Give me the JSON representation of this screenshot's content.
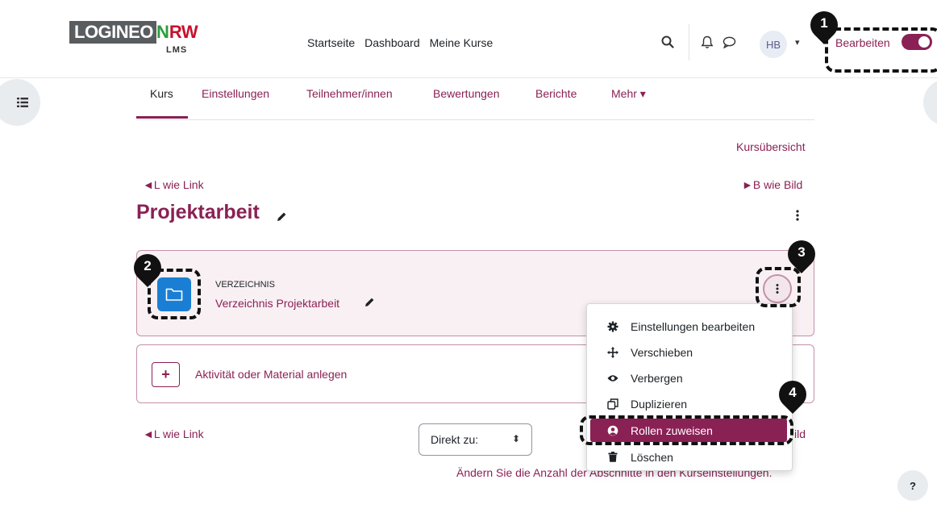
{
  "brand": {
    "logineo": "LOGINEO",
    "nrw_n": "N",
    "nrw_rw": "RW",
    "sub": "LMS"
  },
  "topnav": {
    "items": [
      "Startseite",
      "Dashboard",
      "Meine Kurse"
    ]
  },
  "user": {
    "initials": "HB"
  },
  "edit_mode": {
    "label": "Bearbeiten",
    "on": true
  },
  "tabs": [
    {
      "label": "Kurs"
    },
    {
      "label": "Einstellungen"
    },
    {
      "label": "Teilnehmer/innen"
    },
    {
      "label": "Bewertungen"
    },
    {
      "label": "Berichte"
    },
    {
      "label": "Mehr ▾"
    }
  ],
  "course_overview": "Kursübersicht",
  "nav": {
    "prev_top": "◄L wie Link",
    "next_top": "►B wie Bild",
    "prev_bottom": "◄L wie Link",
    "next_bottom": "ild"
  },
  "section": {
    "title": "Projektarbeit"
  },
  "activity": {
    "type": "VERZEICHNIS",
    "name": "Verzeichnis Projektarbeit"
  },
  "add_activity": {
    "label": "Aktivität oder Material anlegen"
  },
  "jump": {
    "label": "Direkt zu:"
  },
  "sections_hint": "Ändern Sie die Anzahl der Abschnitte in den Kurseinstellungen.",
  "action_menu": {
    "items": [
      {
        "label": "Einstellungen bearbeiten",
        "icon": "gear-icon"
      },
      {
        "label": "Verschieben",
        "icon": "move-icon"
      },
      {
        "label": "Verbergen",
        "icon": "eye-icon"
      },
      {
        "label": "Duplizieren",
        "icon": "copy-icon"
      },
      {
        "label": "Rollen zuweisen",
        "icon": "user-circle-icon",
        "highlighted": true
      },
      {
        "label": "Löschen",
        "icon": "trash-icon"
      }
    ]
  },
  "help": {
    "label": "?"
  },
  "annotations": {
    "pins": [
      "1",
      "2",
      "3",
      "4"
    ]
  },
  "colors": {
    "accent": "#8a2155",
    "card_bg": "#f9f0f4",
    "folder_blue": "#1a7fd4"
  }
}
